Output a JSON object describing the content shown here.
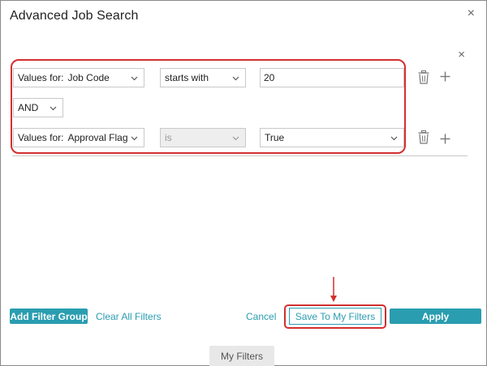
{
  "dialog": {
    "title": "Advanced Job Search",
    "close_symbol": "×",
    "group_close_symbol": "×"
  },
  "filter_rows": [
    {
      "field_prefix": "Values for:",
      "field_value": "Job Code",
      "operator": "starts with",
      "value": "20"
    },
    {
      "field_prefix": "Values for:",
      "field_value": "Approval Flag",
      "operator": "is",
      "operator_disabled": true,
      "value": "True"
    }
  ],
  "conjunction": "AND",
  "icons": {
    "delete": "trash-icon",
    "add": "plus-icon",
    "dropdown": "chevron-down-icon"
  },
  "footer": {
    "add_filter_group": "Add Filter Group",
    "clear_all_filters": "Clear All Filters",
    "cancel": "Cancel",
    "save_to_my_filters": "Save To My Filters",
    "apply": "Apply",
    "my_filters_tab": "My Filters"
  },
  "colors": {
    "accent": "#2a9db0",
    "highlight": "#d32f2f",
    "border": "#c9c9c9"
  }
}
